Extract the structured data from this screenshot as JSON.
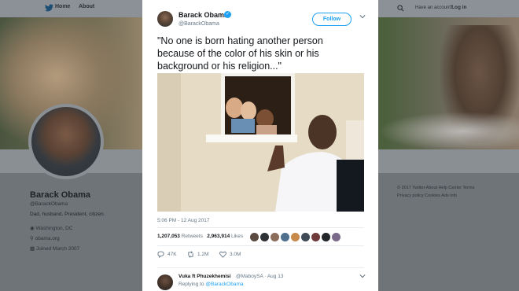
{
  "background_page": {
    "nav": {
      "home": "Home",
      "about": "About",
      "account_prompt": "Have an account?",
      "login": "Log in"
    },
    "profile": {
      "name": "Barack Obama",
      "handle": "@BarackObama",
      "bio": "Dad, husband, President, citizen.",
      "location": "Washington, DC",
      "website": "obama.org",
      "joined": "Joined March 2007"
    },
    "footer": {
      "line1": "© 2017 Twitter   About   Help Center   Terms",
      "line2": "Privacy policy   Cookies   Ads info"
    }
  },
  "tweet": {
    "author_name": "Barack Obama",
    "author_handle": "@BarackObama",
    "follow_label": "Follow",
    "text": "\"No one is born hating another person because of the color of his skin or his background or his religion...\"",
    "timestamp": "5:06 PM - 12 Aug 2017",
    "retweets_count": "1,207,053",
    "retweets_label": "Retweets",
    "likes_count": "2,963,914",
    "likes_label": "Likes",
    "reply_count": "47K",
    "retweet_action_count": "1.2M",
    "like_action_count": "3.0M"
  },
  "reply": {
    "name": "Vuka ft Phuzekhemisi",
    "handle_time": "@MaboySA · Aug 13",
    "replying_prefix": "Replying to",
    "replying_to": "@BarackObama"
  },
  "colors": {
    "accent": "#1da1f2",
    "text": "#14171a",
    "muted": "#657786"
  },
  "icons": [
    "twitter-bird-icon",
    "search-icon",
    "verified-icon",
    "chevron-down-icon",
    "reply-icon",
    "retweet-icon",
    "heart-icon",
    "link-icon",
    "location-icon",
    "calendar-icon"
  ]
}
